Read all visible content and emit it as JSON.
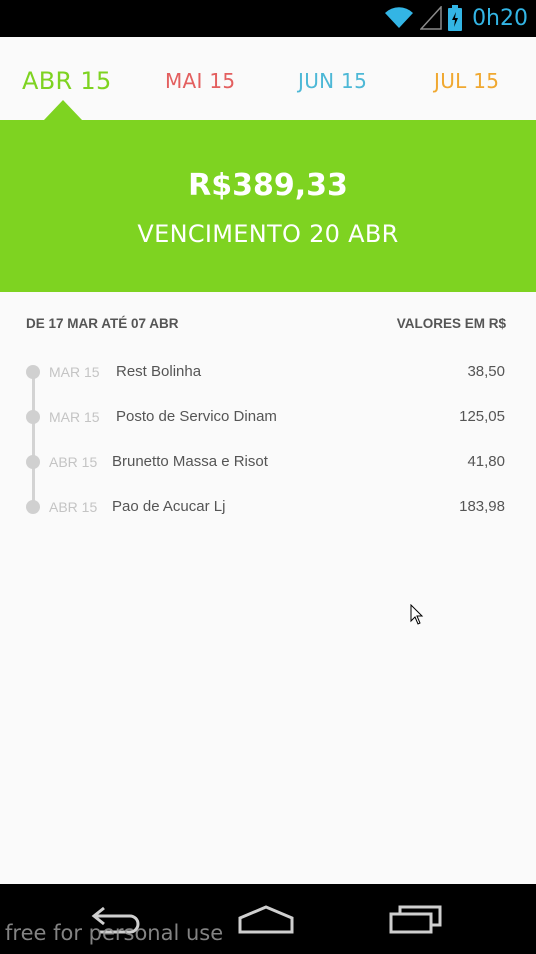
{
  "status_bar": {
    "time": "0h20",
    "icons": [
      "wifi-icon",
      "signal-icon",
      "battery-charging-icon"
    ],
    "accent_color": "#33b5e5"
  },
  "tabs": [
    {
      "label": "ABR 15",
      "color": "#7ed321",
      "active": true
    },
    {
      "label": "MAI 15",
      "color": "#e35f5f",
      "active": false
    },
    {
      "label": "JUN 15",
      "color": "#4db8d6",
      "active": false
    },
    {
      "label": "JUL 15",
      "color": "#f0a830",
      "active": false
    }
  ],
  "invoice": {
    "amount": "R$389,33",
    "due": "VENCIMENTO 20 ABR",
    "band_color": "#7ed321"
  },
  "list": {
    "period": "DE 17 MAR ATÉ 07 ABR",
    "values_label": "VALORES EM R$",
    "items": [
      {
        "date": "MAR 15",
        "description": "Rest Bolinha",
        "value": "38,50"
      },
      {
        "date": "MAR 15",
        "description": "Posto de Servico Dinam",
        "value": "125,05"
      },
      {
        "date": "ABR 15",
        "description": "Brunetto Massa e Risot",
        "value": "41,80"
      },
      {
        "date": "ABR 15",
        "description": "Pao de Acucar Lj",
        "value": "183,98"
      }
    ]
  },
  "nav_bar": {
    "buttons": [
      "back-icon",
      "home-icon",
      "recents-icon"
    ]
  },
  "watermark": "free for personal use"
}
